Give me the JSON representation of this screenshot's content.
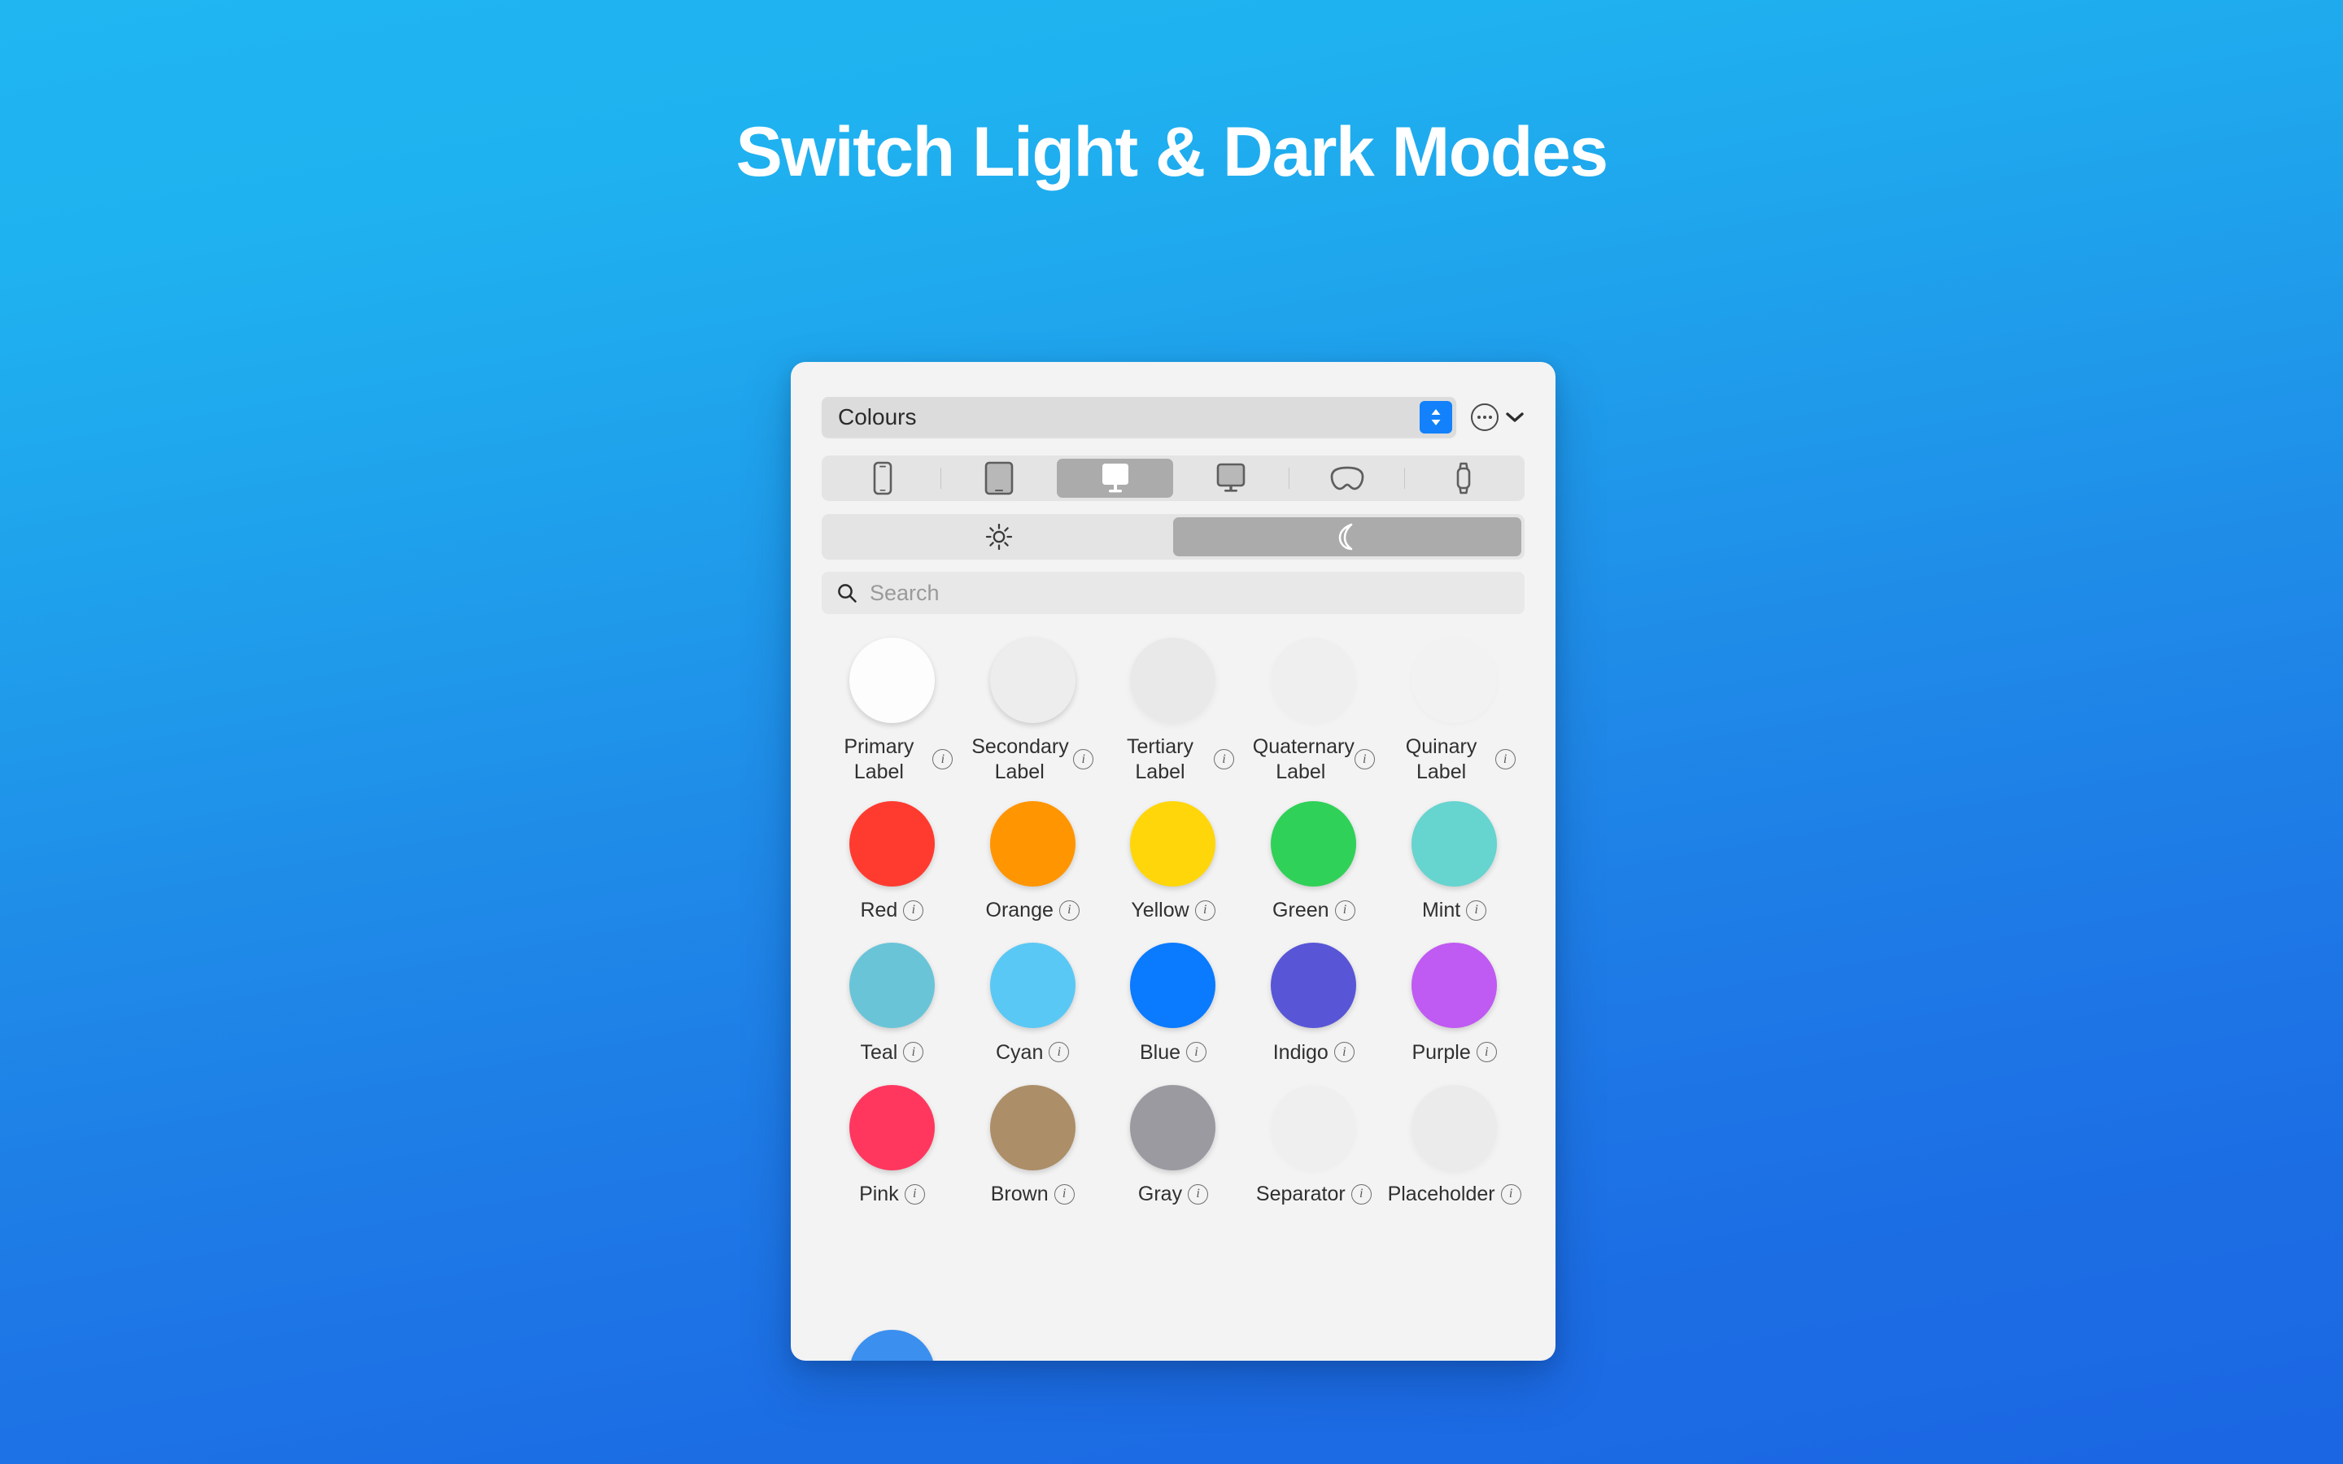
{
  "heading": "Switch Light & Dark Modes",
  "colors": {
    "bg_top": "#1FB6F2",
    "bg_bottom": "#1B66E3",
    "panel_bg": "#F3F3F3",
    "accent_blue": "#1281FB",
    "segment_selected": "#ABABAB"
  },
  "panel": {
    "source": {
      "value": "Colours",
      "stepper_icon": "stepper-up-down-icon",
      "more_icon": "ellipsis-circle-icon",
      "chevron_icon": "chevron-down-icon"
    },
    "devices": [
      {
        "name": "iphone",
        "icon": "iphone-icon",
        "selected": false
      },
      {
        "name": "ipad",
        "icon": "ipad-icon",
        "selected": false
      },
      {
        "name": "mac",
        "icon": "imac-desktop-icon",
        "selected": true
      },
      {
        "name": "display",
        "icon": "display-monitor-icon",
        "selected": false
      },
      {
        "name": "vision",
        "icon": "vision-pro-icon",
        "selected": false
      },
      {
        "name": "watch",
        "icon": "apple-watch-icon",
        "selected": false
      }
    ],
    "appearance": [
      {
        "name": "light",
        "icon": "sun-icon",
        "selected": false
      },
      {
        "name": "dark",
        "icon": "moon-icon",
        "selected": true
      }
    ],
    "search": {
      "placeholder": "Search",
      "value": "",
      "icon": "search-icon"
    },
    "info_glyph": "i",
    "swatch_rows": [
      [
        {
          "label": "Primary Label",
          "two_line": true,
          "color": "#FDFDFD",
          "opacity": 1.0,
          "faint": false
        },
        {
          "label": "Secondary Label",
          "two_line": true,
          "color": "#EDEDED",
          "opacity": 1.0,
          "faint": false
        },
        {
          "label": "Tertiary Label",
          "two_line": true,
          "color": "#E7E7E7",
          "opacity": 1.0,
          "faint": true
        },
        {
          "label": "Quaternary Label",
          "two_line": true,
          "color": "#EFEFEF",
          "opacity": 1.0,
          "faint": true
        },
        {
          "label": "Quinary Label",
          "two_line": true,
          "color": "#F2F2F2",
          "opacity": 1.0,
          "faint": true
        }
      ],
      [
        {
          "label": "Red",
          "two_line": false,
          "color": "#FF3B30",
          "opacity": 1.0,
          "faint": false
        },
        {
          "label": "Orange",
          "two_line": false,
          "color": "#FF9500",
          "opacity": 1.0,
          "faint": false
        },
        {
          "label": "Yellow",
          "two_line": false,
          "color": "#FFD60A",
          "opacity": 1.0,
          "faint": false
        },
        {
          "label": "Green",
          "two_line": false,
          "color": "#30D158",
          "opacity": 1.0,
          "faint": false
        },
        {
          "label": "Mint",
          "two_line": false,
          "color": "#66D4CF",
          "opacity": 1.0,
          "faint": false
        }
      ],
      [
        {
          "label": "Teal",
          "two_line": false,
          "color": "#6AC4D8",
          "opacity": 1.0,
          "faint": false
        },
        {
          "label": "Cyan",
          "two_line": false,
          "color": "#5AC8F5",
          "opacity": 1.0,
          "faint": false
        },
        {
          "label": "Blue",
          "two_line": false,
          "color": "#0A7AFF",
          "opacity": 1.0,
          "faint": false
        },
        {
          "label": "Indigo",
          "two_line": false,
          "color": "#5856D6",
          "opacity": 1.0,
          "faint": false
        },
        {
          "label": "Purple",
          "two_line": false,
          "color": "#BF5AF2",
          "opacity": 1.0,
          "faint": false
        }
      ],
      [
        {
          "label": "Pink",
          "two_line": false,
          "color": "#FF375F",
          "opacity": 1.0,
          "faint": false
        },
        {
          "label": "Brown",
          "two_line": false,
          "color": "#AC8E68",
          "opacity": 1.0,
          "faint": false
        },
        {
          "label": "Gray",
          "two_line": false,
          "color": "#9A9AA0",
          "opacity": 1.0,
          "faint": false
        },
        {
          "label": "Separator",
          "two_line": false,
          "color": "#EFEFEF",
          "opacity": 1.0,
          "faint": true
        },
        {
          "label": "Placeholder",
          "two_line": false,
          "color": "#EBEBEB",
          "opacity": 1.0,
          "faint": true
        }
      ]
    ],
    "cut_off_row": [
      {
        "label": "",
        "color": "#3B8FEF"
      }
    ]
  }
}
